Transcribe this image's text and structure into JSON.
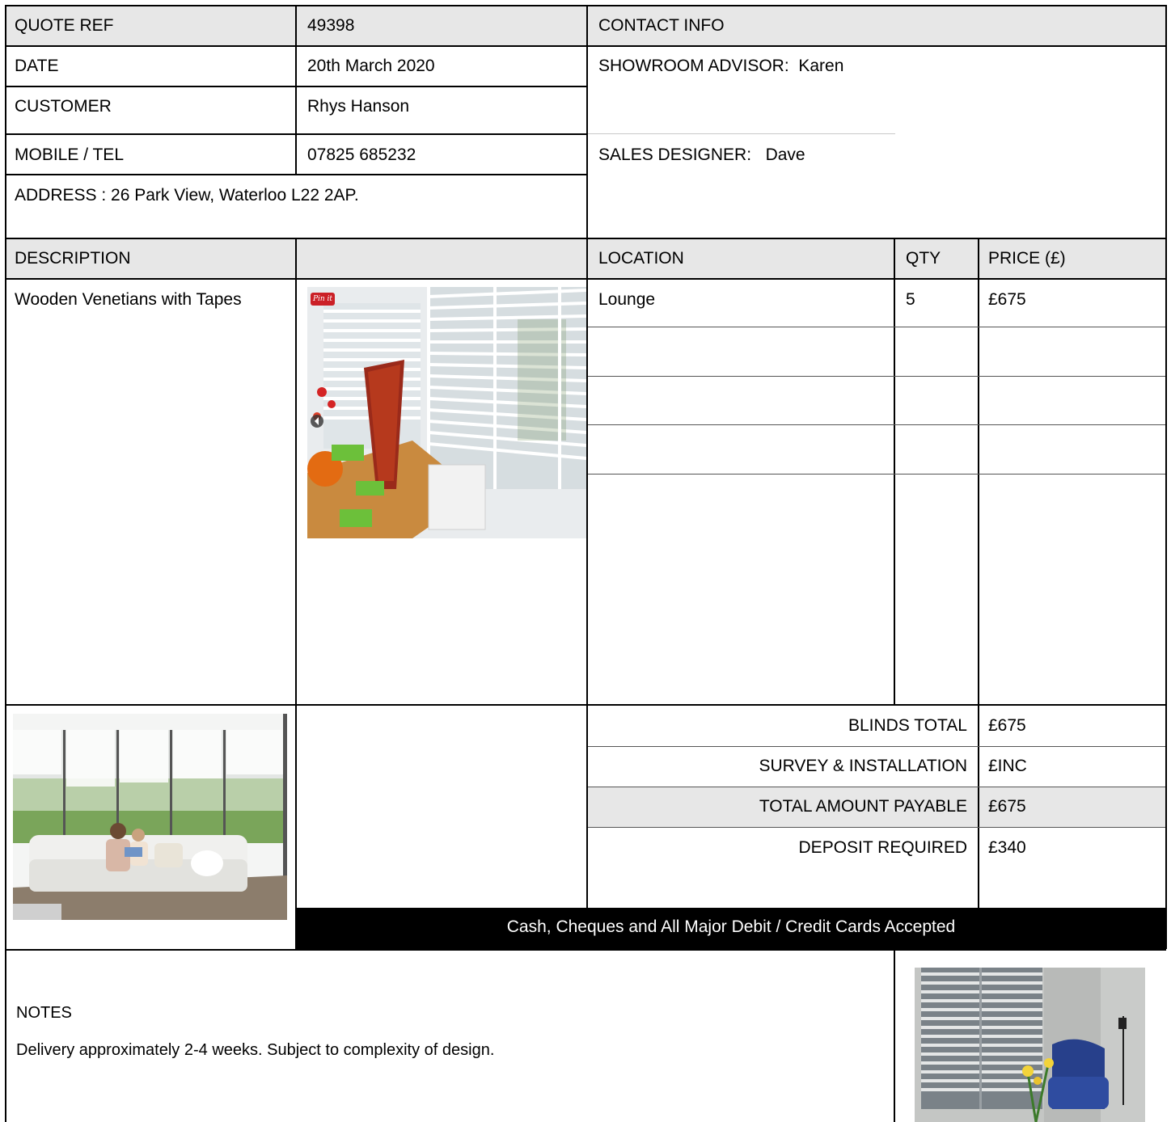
{
  "header": {
    "quote_ref_label": "QUOTE REF",
    "quote_ref_value": "49398",
    "contact_info_label": "CONTACT INFO",
    "date_label": "DATE",
    "date_value": "20th March 2020",
    "showroom_label": "SHOWROOM ADVISOR:",
    "showroom_value": "Karen",
    "customer_label": "CUSTOMER",
    "customer_value": "Rhys Hanson",
    "mobile_label": "MOBILE / TEL",
    "mobile_value": "07825 685232",
    "designer_label": "SALES DESIGNER:",
    "designer_value": "Dave",
    "address_text": "ADDRESS :  26 Park View, Waterloo L22 2AP."
  },
  "items_table": {
    "headers": {
      "description": "DESCRIPTION",
      "location": "LOCATION",
      "qty": "QTY",
      "price": "PRICE (£)"
    },
    "rows": [
      {
        "description": "Wooden Venetians with Tapes",
        "location": "Lounge",
        "qty": "5",
        "price": "£675"
      }
    ],
    "pin_badge": "Pin it"
  },
  "totals": {
    "blinds_total_label": "BLINDS TOTAL",
    "blinds_total_value": "£675",
    "survey_label": "SURVEY & INSTALLATION",
    "survey_value": "£INC",
    "payable_label": "TOTAL AMOUNT PAYABLE",
    "payable_value": "£675",
    "deposit_label": "DEPOSIT REQUIRED",
    "deposit_value": "£340",
    "payment_banner": "Cash, Cheques and All Major Debit / Credit Cards Accepted"
  },
  "notes": {
    "title": "NOTES",
    "text": "Delivery approximately 2-4 weeks. Subject to complexity of design."
  },
  "colors": {
    "header_grey": "#e7e7e7",
    "banner_bg": "#000000",
    "banner_text": "#ffffff"
  }
}
